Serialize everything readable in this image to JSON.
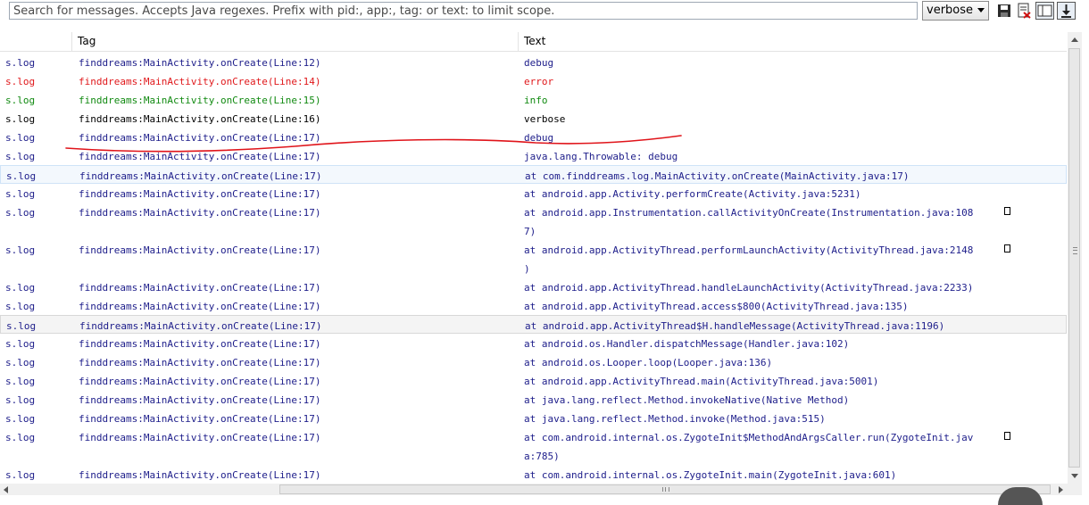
{
  "toolbar": {
    "search_placeholder": "Search for messages. Accepts Java regexes. Prefix with pid:, app:, tag: or text: to limit scope.",
    "log_level": "verbose",
    "buttons": [
      "save-icon",
      "clear-log-icon",
      "toggle-panel-icon",
      "scroll-lock-icon"
    ]
  },
  "columns": {
    "app": "",
    "tag": "Tag",
    "text": "Text"
  },
  "colors": {
    "debug": "#1d1d8a",
    "error": "#e0181b",
    "info": "#118a11",
    "verbose": "#000000",
    "annotation": "#e0141a"
  },
  "rows": [
    {
      "app": "s.log",
      "tag": "finddreams:MainActivity.onCreate(Line:12)",
      "text": "debug",
      "level": "d"
    },
    {
      "app": "s.log",
      "tag": "finddreams:MainActivity.onCreate(Line:14)",
      "text": "error",
      "level": "e"
    },
    {
      "app": "s.log",
      "tag": "finddreams:MainActivity.onCreate(Line:15)",
      "text": "info",
      "level": "i"
    },
    {
      "app": "s.log",
      "tag": "finddreams:MainActivity.onCreate(Line:16)",
      "text": "verbose",
      "level": "v"
    },
    {
      "app": "s.log",
      "tag": "finddreams:MainActivity.onCreate(Line:17)",
      "text": "debug",
      "level": "d"
    },
    {
      "app": "s.log",
      "tag": "finddreams:MainActivity.onCreate(Line:17)",
      "text": "java.lang.Throwable: debug",
      "level": "d"
    },
    {
      "app": "s.log",
      "tag": "finddreams:MainActivity.onCreate(Line:17)",
      "text": "at com.finddreams.log.MainActivity.onCreate(MainActivity.java:17)",
      "level": "d",
      "selected": "blue"
    },
    {
      "app": "s.log",
      "tag": "finddreams:MainActivity.onCreate(Line:17)",
      "text": "at android.app.Activity.performCreate(Activity.java:5231)",
      "level": "d"
    },
    {
      "app": "s.log",
      "tag": "finddreams:MainActivity.onCreate(Line:17)",
      "text": "at android.app.Instrumentation.callActivityOnCreate(Instrumentation.java:108",
      "text2": "7)",
      "level": "d"
    },
    {
      "app": "s.log",
      "tag": "finddreams:MainActivity.onCreate(Line:17)",
      "text": "at android.app.ActivityThread.performLaunchActivity(ActivityThread.java:2148",
      "text2": ")",
      "level": "d"
    },
    {
      "app": "s.log",
      "tag": "finddreams:MainActivity.onCreate(Line:17)",
      "text": "at android.app.ActivityThread.handleLaunchActivity(ActivityThread.java:2233)",
      "level": "d"
    },
    {
      "app": "s.log",
      "tag": "finddreams:MainActivity.onCreate(Line:17)",
      "text": "at android.app.ActivityThread.access$800(ActivityThread.java:135)",
      "level": "d"
    },
    {
      "app": "s.log",
      "tag": "finddreams:MainActivity.onCreate(Line:17)",
      "text": "at android.app.ActivityThread$H.handleMessage(ActivityThread.java:1196)",
      "level": "d",
      "selected": "gray"
    },
    {
      "app": "s.log",
      "tag": "finddreams:MainActivity.onCreate(Line:17)",
      "text": "at android.os.Handler.dispatchMessage(Handler.java:102)",
      "level": "d"
    },
    {
      "app": "s.log",
      "tag": "finddreams:MainActivity.onCreate(Line:17)",
      "text": "at android.os.Looper.loop(Looper.java:136)",
      "level": "d"
    },
    {
      "app": "s.log",
      "tag": "finddreams:MainActivity.onCreate(Line:17)",
      "text": "at android.app.ActivityThread.main(ActivityThread.java:5001)",
      "level": "d"
    },
    {
      "app": "s.log",
      "tag": "finddreams:MainActivity.onCreate(Line:17)",
      "text": "at java.lang.reflect.Method.invokeNative(Native Method)",
      "level": "d"
    },
    {
      "app": "s.log",
      "tag": "finddreams:MainActivity.onCreate(Line:17)",
      "text": "at java.lang.reflect.Method.invoke(Method.java:515)",
      "level": "d"
    },
    {
      "app": "s.log",
      "tag": "finddreams:MainActivity.onCreate(Line:17)",
      "text": "at com.android.internal.os.ZygoteInit$MethodAndArgsCaller.run(ZygoteInit.jav",
      "text2": "a:785)",
      "level": "d"
    },
    {
      "app": "s.log",
      "tag": "finddreams:MainActivity.onCreate(Line:17)",
      "text": "at com.android.internal.os.ZygoteInit.main(ZygoteInit.java:601)",
      "level": "d"
    }
  ]
}
